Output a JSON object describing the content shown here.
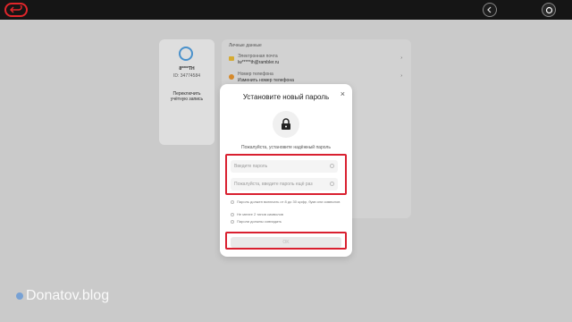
{
  "topbar": {
    "back_label": ""
  },
  "profile": {
    "name": "8****TH",
    "id_text": "ID: 34774584",
    "switch_label": "Переключить учётную запись"
  },
  "personal": {
    "section_title": "Личные данные",
    "items": [
      {
        "label": "Электронная почта",
        "value": "lw*****th@rambler.ru"
      },
      {
        "label": "Номер телефона",
        "value": "Изменить номер телефона"
      }
    ]
  },
  "modal": {
    "title": "Установите новый пароль",
    "hint": "Пожалуйста, установите надёжный пароль",
    "password_placeholder": "Введите пароль",
    "confirm_placeholder": "Пожалуйста, введите пароль ещё раз",
    "rules": [
      "Пароль должен включать от 8 до 30 цифр, букв или символов",
      "Не менее 2 типов символов",
      "Пароли должны совпадать"
    ],
    "ok_label": "OK",
    "close_label": "×"
  },
  "watermark": {
    "text": "Donatov.blog"
  }
}
